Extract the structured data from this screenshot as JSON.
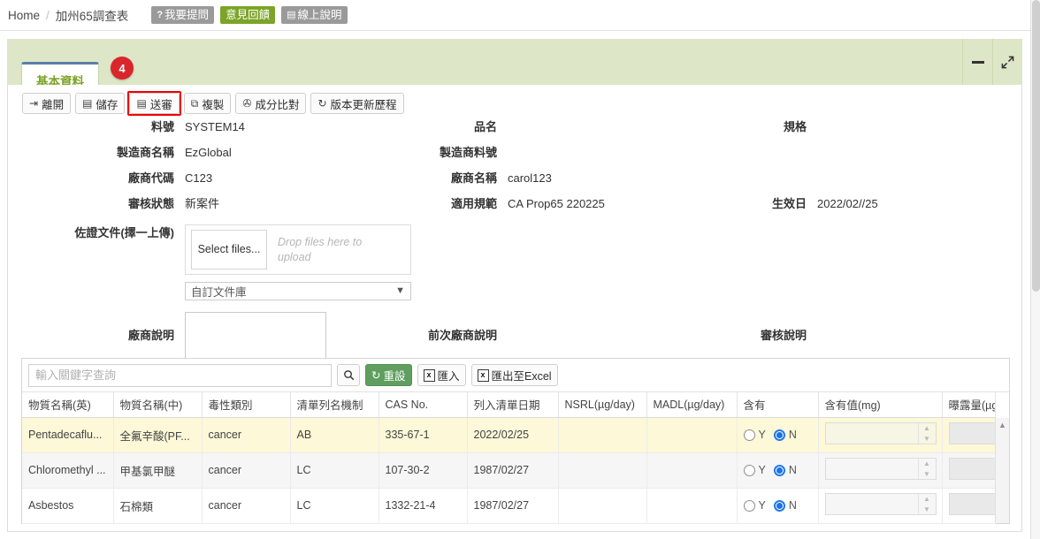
{
  "breadcrumb": {
    "home": "Home",
    "separator": "/",
    "current": "加州65調查表",
    "buttons": [
      {
        "name": "ask-question",
        "icon": "question-mark-icon",
        "glyph": "?",
        "label": "我要提問",
        "style": "gray"
      },
      {
        "name": "feedback",
        "icon": "feedback-icon",
        "glyph": "",
        "label": "意見回饋",
        "style": "green"
      },
      {
        "name": "online-help",
        "icon": "book-icon",
        "glyph": "▤",
        "label": "線上說明",
        "style": "gray"
      }
    ]
  },
  "panel": {
    "tab_label": "基本資料",
    "badge": "4",
    "minimize_title": "最小化",
    "expand_icon": "expand-arrows-icon",
    "expand_glyph": "⤢"
  },
  "toolbar": {
    "buttons": [
      {
        "name": "leave",
        "icon": "exit-icon",
        "glyph": "⇥",
        "label": "離開",
        "highlight": false
      },
      {
        "name": "save",
        "icon": "save-disk-icon",
        "glyph": "▤",
        "label": "儲存",
        "highlight": false
      },
      {
        "name": "submit-review",
        "icon": "save-disk-icon",
        "glyph": "▤",
        "label": "送審",
        "highlight": true
      },
      {
        "name": "copy",
        "icon": "copy-icon",
        "glyph": "⧉",
        "label": "複製",
        "highlight": false
      },
      {
        "name": "compare-composition",
        "icon": "link-icon",
        "glyph": "✇",
        "label": "成分比對",
        "highlight": false
      },
      {
        "name": "version-history",
        "icon": "undo-icon",
        "glyph": "↻",
        "label": "版本更新歷程",
        "highlight": false
      }
    ]
  },
  "form": {
    "rows": [
      {
        "left_label": "料號",
        "left_value": "SYSTEM14",
        "mid_label": "品名",
        "mid_value": "",
        "right_label": "規格",
        "right_value": ""
      },
      {
        "left_label": "製造商名稱",
        "left_value": "EzGlobal",
        "mid_label": "製造商料號",
        "mid_value": "",
        "right_label": "",
        "right_value": ""
      },
      {
        "left_label": "廠商代碼",
        "left_value": "C123",
        "mid_label": "廠商名稱",
        "mid_value": "carol123",
        "right_label": "",
        "right_value": ""
      },
      {
        "left_label": "審核狀態",
        "left_value": "新案件",
        "mid_label": "適用規範",
        "mid_value": "CA Prop65 220225",
        "right_label": "生效日",
        "right_value": "2022/02//25"
      }
    ],
    "upload": {
      "label": "佐證文件(擇一上傳)",
      "select_files_label": "Select files...",
      "drop_hint": "Drop files here to upload",
      "library_select_value": "自訂文件庫",
      "caret_icon": "chevron-down-icon"
    },
    "notes": {
      "vendor_label": "廠商說明",
      "vendor_value": "",
      "previous_vendor_label": "前次廠商說明",
      "previous_vendor_value": "",
      "review_label": "審核說明",
      "review_value": ""
    }
  },
  "grid": {
    "search_placeholder": "輸入關鍵字查詢",
    "search_value": "",
    "tools": [
      {
        "name": "search-button",
        "icon": "search-icon",
        "glyph": "⌕",
        "label": "",
        "style": "plain"
      },
      {
        "name": "reset-button",
        "icon": "reset-icon",
        "glyph": "↻",
        "label": "重設",
        "style": "green"
      },
      {
        "name": "import-button",
        "icon": "excel-icon",
        "glyph": "x",
        "label": "匯入",
        "style": "plain"
      },
      {
        "name": "export-excel-button",
        "icon": "excel-icon",
        "glyph": "x",
        "label": "匯出至Excel",
        "style": "plain"
      }
    ],
    "columns": [
      "物質名稱(英)",
      "物質名稱(中)",
      "毒性類別",
      "清單列名機制",
      "CAS No.",
      "列入清單日期",
      "NSRL(µg/day)",
      "MADL(µg/day)",
      "含有",
      "含有值(mg)",
      "曝露量(µg"
    ],
    "radio_yes_label": "Y",
    "radio_no_label": "N",
    "rows": [
      {
        "state": "selected",
        "name_en": "Pentadecaflu...",
        "name_zh": "全氟辛酸(PF...",
        "toxicity": "cancer",
        "mechanism": "AB",
        "cas": "335-67-1",
        "listed_date": "2022/02/25",
        "nsrl": "",
        "madl": "",
        "contains": "N",
        "content_value": "",
        "exposure": ""
      },
      {
        "state": "alt",
        "name_en": "Chloromethyl ...",
        "name_zh": "甲基氯甲醚",
        "toxicity": "cancer",
        "mechanism": "LC",
        "cas": "107-30-2",
        "listed_date": "1987/02/27",
        "nsrl": "",
        "madl": "",
        "contains": "N",
        "content_value": "",
        "exposure": ""
      },
      {
        "state": "plain",
        "name_en": "Asbestos",
        "name_zh": "石棉類",
        "toxicity": "cancer",
        "mechanism": "LC",
        "cas": "1332-21-4",
        "listed_date": "1987/02/27",
        "nsrl": "",
        "madl": "",
        "contains": "N",
        "content_value": "",
        "exposure": ""
      }
    ],
    "scroll_up_icon": "triangle-up-icon"
  },
  "colors": {
    "panel_green": "#dde7c7",
    "tab_text_green": "#7ba428",
    "badge_red": "#d9262c",
    "highlight_red": "#ef0000",
    "row_selected_yellow": "#fcf8d8",
    "reset_button_green": "#5f9e5f",
    "radio_blue": "#1a73e8"
  }
}
